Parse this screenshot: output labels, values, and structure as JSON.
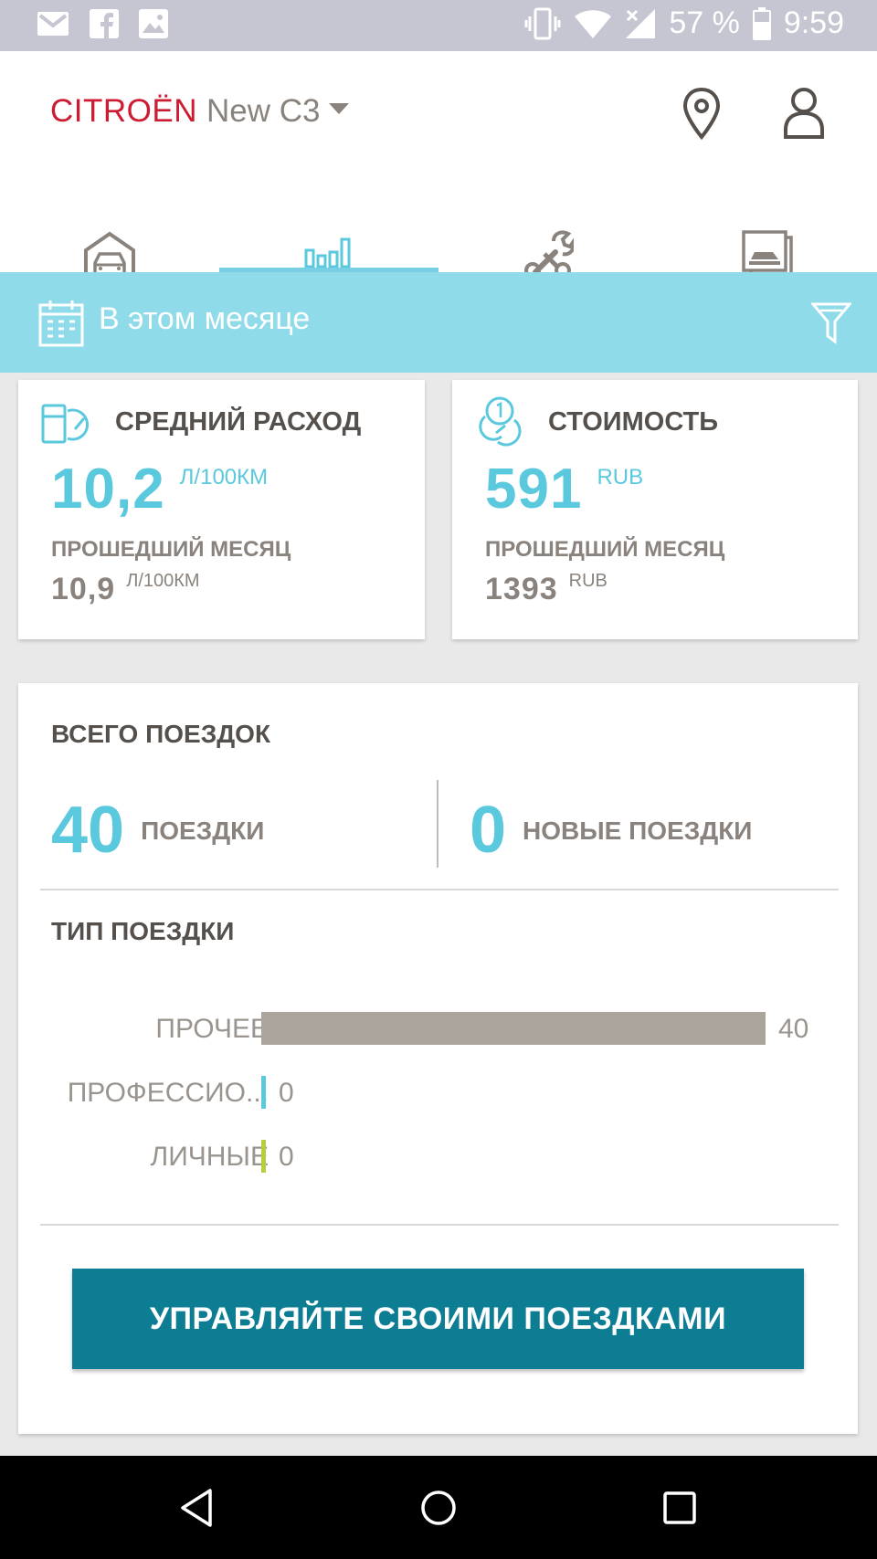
{
  "status_bar": {
    "battery_text": "57 %",
    "time": "9:59",
    "icons": [
      "gmail-icon",
      "facebook-icon",
      "image-icon",
      "vibrate-icon",
      "wifi-icon",
      "signal-icon",
      "battery-icon"
    ]
  },
  "header": {
    "brand": "CITROËN",
    "model": "New C3",
    "icons": [
      "location-pin-icon",
      "profile-icon"
    ]
  },
  "tabs": [
    {
      "icon": "garage-icon",
      "active": false
    },
    {
      "icon": "stats-icon",
      "active": true
    },
    {
      "icon": "wrench-icon",
      "active": false
    },
    {
      "icon": "gallery-icon",
      "active": false
    }
  ],
  "filter": {
    "label": "В этом месяце",
    "icons": [
      "calendar-icon",
      "filter-icon"
    ]
  },
  "consumption": {
    "title": "СРЕДНИЙ РАСХОД",
    "value": "10,2",
    "unit": "Л/100КМ",
    "prev_label": "ПРОШЕДШИЙ МЕСЯЦ",
    "prev_value": "10,9",
    "prev_unit": "Л/100КМ"
  },
  "cost": {
    "title": "СТОИМОСТЬ",
    "value": "591",
    "unit": "RUB",
    "prev_label": "ПРОШЕДШИЙ МЕСЯЦ",
    "prev_value": "1393",
    "prev_unit": "RUB"
  },
  "trips": {
    "title": "ВСЕГО ПОЕЗДОК",
    "total": "40",
    "total_label": "ПОЕЗДКИ",
    "new": "0",
    "new_label": "НОВЫЕ ПОЕЗДКИ",
    "type_title": "ТИП ПОЕЗДКИ"
  },
  "chart_data": {
    "type": "bar",
    "orientation": "horizontal",
    "categories": [
      "ПРОЧЕЕ",
      "ПРОФЕССИО...",
      "ЛИЧНЫЕ"
    ],
    "values": [
      40,
      0,
      0
    ],
    "value_labels": [
      "40",
      "0",
      "0"
    ],
    "colors": [
      "#aba49c",
      "#5ac8dd",
      "#b5cf3c"
    ],
    "xlim": [
      0,
      40
    ]
  },
  "cta": {
    "label": "УПРАВЛЯЙТЕ СВОИМИ ПОЕЗДКАМИ"
  },
  "nav_bar": {
    "icons": [
      "back-icon",
      "home-icon",
      "recents-icon"
    ]
  }
}
